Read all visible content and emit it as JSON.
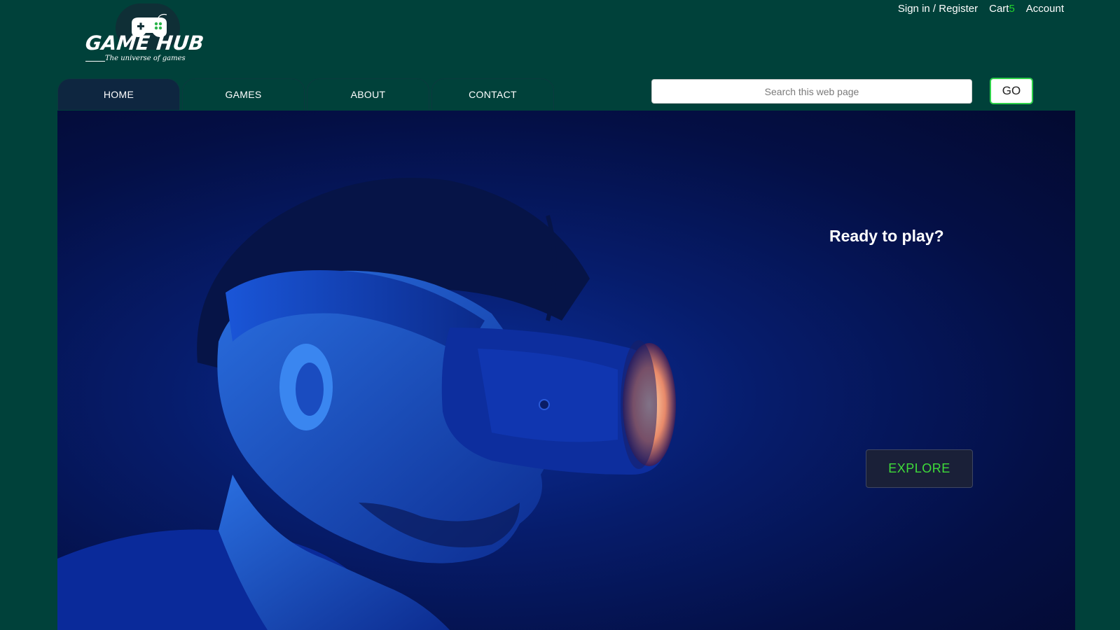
{
  "logo": {
    "title": "GAME HUB",
    "tagline": "The universe of games",
    "icon": "gamepad-icon"
  },
  "top_links": {
    "sign_in": "Sign in / Register",
    "cart_label": "Cart",
    "cart_count": "5",
    "account": "Account"
  },
  "nav": {
    "tabs": [
      {
        "label": "HOME",
        "active": true
      },
      {
        "label": "GAMES",
        "active": false
      },
      {
        "label": "ABOUT",
        "active": false
      },
      {
        "label": "CONTACT",
        "active": false
      }
    ]
  },
  "search": {
    "placeholder": "Search this web page",
    "value": "",
    "button_label": "GO"
  },
  "hero": {
    "heading": "Ready to play?",
    "button_label": "EXPLORE",
    "image": "person-wearing-vr-headset"
  },
  "colors": {
    "page_background": "#00413a",
    "accent_green": "#22d32c",
    "hero_blue": "#061c6b"
  }
}
